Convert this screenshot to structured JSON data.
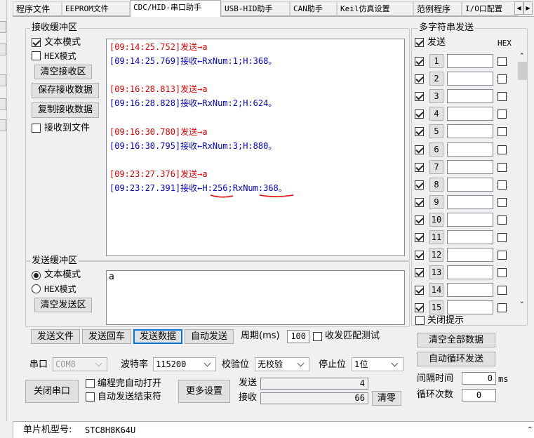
{
  "tabs": [
    "程序文件",
    "EEPROM文件",
    "CDC/HID-串口助手",
    "USB-HID助手",
    "CAN助手",
    "Keil仿真设置",
    "范例程序",
    "I/O口配置"
  ],
  "active_tab": "CDC/HID-串口助手",
  "receive": {
    "title": "接收缓冲区",
    "text_mode": "文本模式",
    "hex_mode": "HEX模式",
    "clear": "清空接收区",
    "save": "保存接收数据",
    "copy": "复制接收数据",
    "to_file": "接收到文件",
    "log": [
      {
        "time": "[09:14:25.752]",
        "dir": "发送→",
        "body": "a",
        "color": "red"
      },
      {
        "time": "[09:14:25.769]",
        "dir": "接收←",
        "body": "RxNum:1;H:368。",
        "color": "blue"
      },
      {
        "time": "[09:16:28.813]",
        "dir": "发送→",
        "body": "a",
        "color": "red"
      },
      {
        "time": "[09:16:28.828]",
        "dir": "接收←",
        "body": "RxNum:2;H:624。",
        "color": "blue"
      },
      {
        "time": "[09:16:30.780]",
        "dir": "发送→",
        "body": "a",
        "color": "red"
      },
      {
        "time": "[09:16:30.795]",
        "dir": "接收←",
        "body": "RxNum:3;H:880。",
        "color": "blue"
      },
      {
        "time": "[09:23:27.376]",
        "dir": "发送→",
        "body": "a",
        "color": "red"
      },
      {
        "time": "[09:23:27.391]",
        "dir": "接收←",
        "body": "H:256;RxNum:368。",
        "color": "blue"
      }
    ]
  },
  "send": {
    "title": "发送缓冲区",
    "text_mode": "文本模式",
    "hex_mode": "HEX模式",
    "clear": "清空发送区",
    "content": "a"
  },
  "actions": {
    "send_file": "发送文件",
    "send_enter": "发送回车",
    "send_data": "发送数据",
    "auto_send": "自动发送",
    "period_label": "周期(ms)",
    "period_value": "100",
    "match_test": "收发匹配测试"
  },
  "port": {
    "label": "串口",
    "value": "COM8",
    "baud_label": "波特率",
    "baud_value": "115200",
    "parity_label": "校验位",
    "parity_value": "无校验",
    "stop_label": "停止位",
    "stop_value": "1位",
    "close_port": "关闭串口",
    "auto_open": "编程完自动打开",
    "auto_end": "自动发送结束符",
    "more": "更多设置",
    "send_count_label": "发送",
    "send_count": "4",
    "recv_count_label": "接收",
    "recv_count": "66",
    "clear_count": "清零"
  },
  "multi": {
    "title": "多字符串发送",
    "send_label": "发送",
    "hex_label": "HEX",
    "rows": [
      "1",
      "2",
      "3",
      "4",
      "5",
      "6",
      "7",
      "8",
      "9",
      "10",
      "11",
      "12",
      "13",
      "14",
      "15"
    ],
    "close_tip": "关闭提示",
    "clear_all": "清空全部数据",
    "auto_loop": "自动循环发送",
    "interval_label": "间隔时间",
    "interval_value": "0",
    "interval_unit": "ms",
    "loop_label": "循环次数",
    "loop_value": "0"
  },
  "status": {
    "mcu_label": "单片机型号:",
    "mcu_value": "STC8H8K64U"
  },
  "colors": {
    "send_text": "#e00000",
    "recv_text": "#0000d0",
    "annotation": "#e00000"
  }
}
